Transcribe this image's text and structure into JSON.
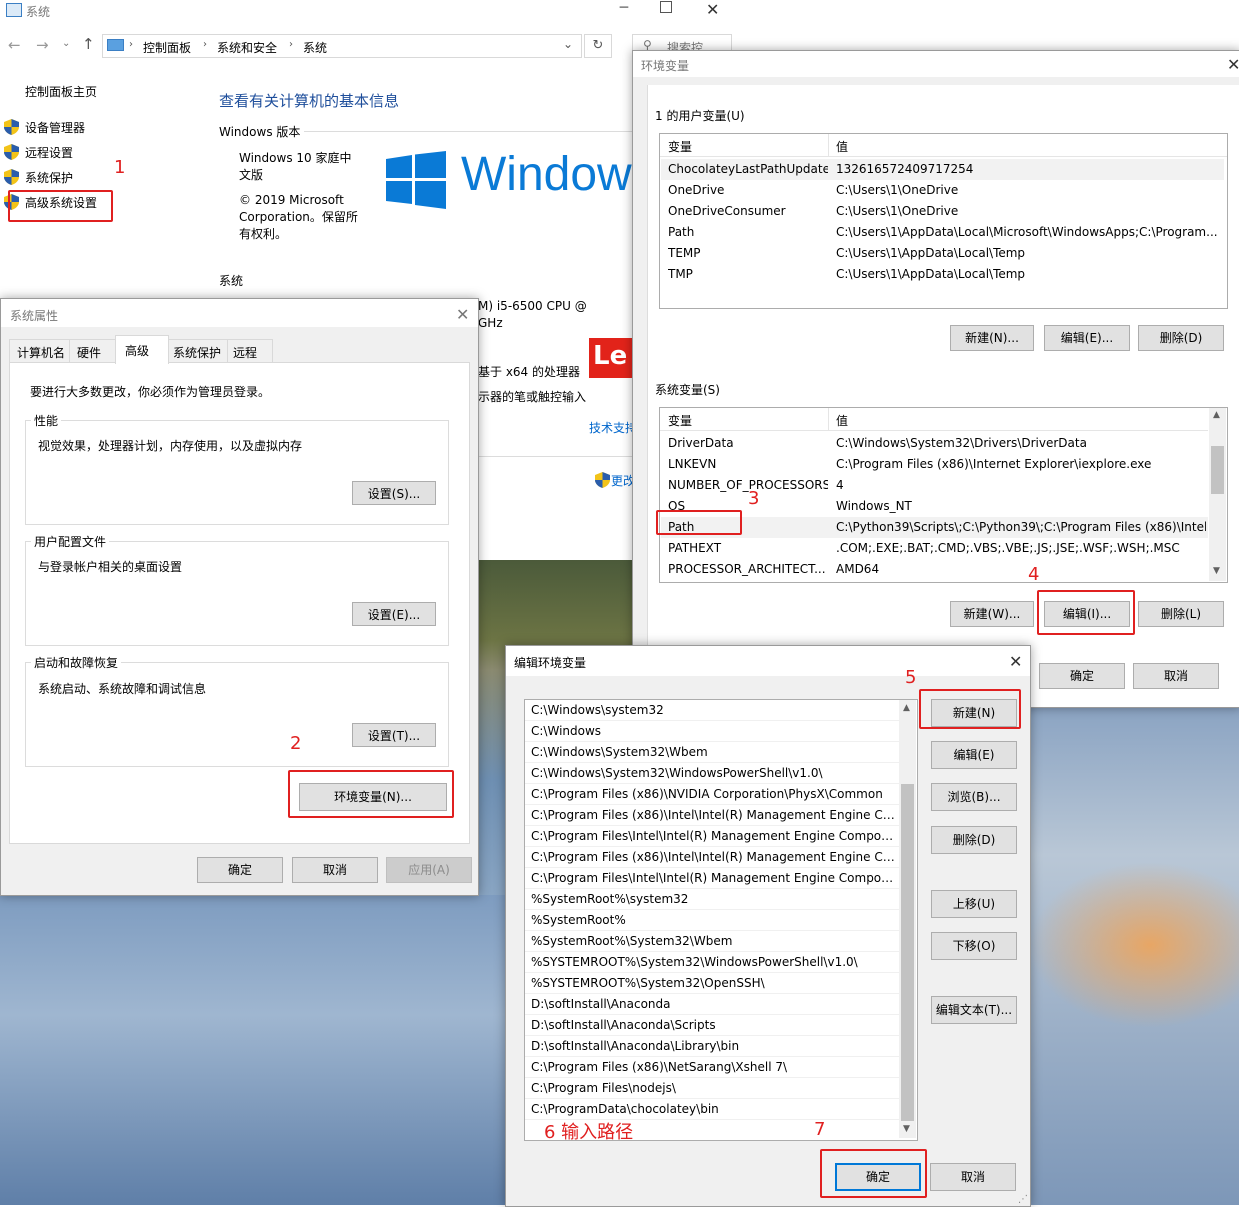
{
  "system_window": {
    "title": "系统",
    "breadcrumb": [
      "控制面板",
      "系统和安全",
      "系统"
    ],
    "search_placeholder": "搜索控",
    "sidebar_home": "控制面板主页",
    "sidebar_items": [
      "设备管理器",
      "远程设置",
      "系统保护",
      "高级系统设置"
    ],
    "heading": "查看有关计算机的基本信息",
    "edition_section": "Windows 版本",
    "edition_name": "Windows 10 家庭中文版",
    "copyright": "© 2019 Microsoft Corporation。保留所有权利。",
    "logo_text": "Window",
    "system_section": "系统",
    "cpu_fragment": "M) i5-6500 CPU @",
    "ghz_fragment": "GHz",
    "x64_fragment": "基于 x64 的处理器",
    "pen_fragment": "示器的笔或触控输入",
    "support_link": "技术支持",
    "change_link": "更改",
    "brand_text": "Le"
  },
  "sysprops": {
    "title": "系统属性",
    "tabs": [
      "计算机名",
      "硬件",
      "高级",
      "系统保护",
      "远程"
    ],
    "admin_note": "要进行大多数更改，你必须作为管理员登录。",
    "perf": {
      "label": "性能",
      "desc": "视觉效果，处理器计划，内存使用，以及虚拟内存",
      "button": "设置(S)..."
    },
    "profile": {
      "label": "用户配置文件",
      "desc": "与登录帐户相关的桌面设置",
      "button": "设置(E)..."
    },
    "startup": {
      "label": "启动和故障恢复",
      "desc": "系统启动、系统故障和调试信息",
      "button": "设置(T)..."
    },
    "env_button": "环境变量(N)...",
    "ok": "确定",
    "cancel": "取消",
    "apply": "应用(A)"
  },
  "envvars": {
    "title": "环境变量",
    "user_section": "1 的用户变量(U)",
    "col_var": "变量",
    "col_val": "值",
    "user_vars": [
      {
        "name": "ChocolateyLastPathUpdate",
        "value": "132616572409717254"
      },
      {
        "name": "OneDrive",
        "value": "C:\\Users\\1\\OneDrive"
      },
      {
        "name": "OneDriveConsumer",
        "value": "C:\\Users\\1\\OneDrive"
      },
      {
        "name": "Path",
        "value": "C:\\Users\\1\\AppData\\Local\\Microsoft\\WindowsApps;C:\\Program..."
      },
      {
        "name": "TEMP",
        "value": "C:\\Users\\1\\AppData\\Local\\Temp"
      },
      {
        "name": "TMP",
        "value": "C:\\Users\\1\\AppData\\Local\\Temp"
      }
    ],
    "user_new": "新建(N)...",
    "user_edit": "编辑(E)...",
    "user_delete": "删除(D)",
    "sys_section": "系统变量(S)",
    "sys_vars": [
      {
        "name": "DriverData",
        "value": "C:\\Windows\\System32\\Drivers\\DriverData"
      },
      {
        "name": "LNKEVN",
        "value": "C:\\Program Files (x86)\\Internet Explorer\\iexplore.exe"
      },
      {
        "name": "NUMBER_OF_PROCESSORS",
        "value": "4"
      },
      {
        "name": "OS",
        "value": "Windows_NT"
      },
      {
        "name": "Path",
        "value": "C:\\Python39\\Scripts\\;C:\\Python39\\;C:\\Program Files (x86)\\Intel..."
      },
      {
        "name": "PATHEXT",
        "value": ".COM;.EXE;.BAT;.CMD;.VBS;.VBE;.JS;.JSE;.WSF;.WSH;.MSC"
      },
      {
        "name": "PROCESSOR_ARCHITECT...",
        "value": "AMD64"
      }
    ],
    "sys_new": "新建(W)...",
    "sys_edit": "编辑(I)...",
    "sys_delete": "删除(L)",
    "ok": "确定",
    "cancel": "取消"
  },
  "editenv": {
    "title": "编辑环境变量",
    "paths": [
      "C:\\Windows\\system32",
      "C:\\Windows",
      "C:\\Windows\\System32\\Wbem",
      "C:\\Windows\\System32\\WindowsPowerShell\\v1.0\\",
      "C:\\Program Files (x86)\\NVIDIA Corporation\\PhysX\\Common",
      "C:\\Program Files (x86)\\Intel\\Intel(R) Management Engine Co...",
      "C:\\Program Files\\Intel\\Intel(R) Management Engine Compon...",
      "C:\\Program Files (x86)\\Intel\\Intel(R) Management Engine Co...",
      "C:\\Program Files\\Intel\\Intel(R) Management Engine Compon...",
      "%SystemRoot%\\system32",
      "%SystemRoot%",
      "%SystemRoot%\\System32\\Wbem",
      "%SYSTEMROOT%\\System32\\WindowsPowerShell\\v1.0\\",
      "%SYSTEMROOT%\\System32\\OpenSSH\\",
      "D:\\softInstall\\Anaconda",
      "D:\\softInstall\\Anaconda\\Scripts",
      "D:\\softInstall\\Anaconda\\Library\\bin",
      "C:\\Program Files (x86)\\NetSarang\\Xshell 7\\",
      "C:\\Program Files\\nodejs\\",
      "C:\\ProgramData\\chocolatey\\bin"
    ],
    "btn_new": "新建(N)",
    "btn_edit": "编辑(E)",
    "btn_browse": "浏览(B)...",
    "btn_delete": "删除(D)",
    "btn_up": "上移(U)",
    "btn_down": "下移(O)",
    "btn_edittext": "编辑文本(T)...",
    "ok": "确定",
    "cancel": "取消"
  },
  "annotations": {
    "n1": "1",
    "n2": "2",
    "n3": "3",
    "n4": "4",
    "n5": "5",
    "n7": "7",
    "n6_text": "6 输入路径"
  }
}
